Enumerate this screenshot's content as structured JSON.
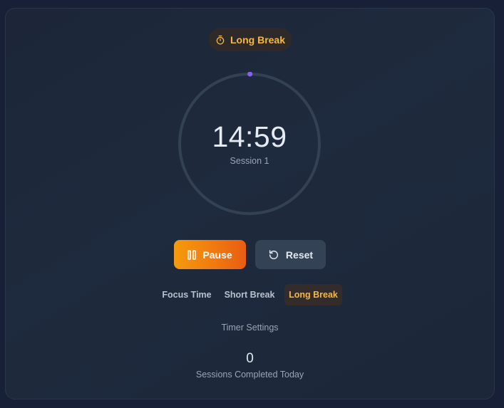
{
  "timer": {
    "mode_badge": "Long Break",
    "time": "14:59",
    "session": "Session 1",
    "progress": 0.001
  },
  "controls": {
    "pause_label": "Pause",
    "reset_label": "Reset"
  },
  "modes": [
    {
      "label": "Focus Time",
      "active": false
    },
    {
      "label": "Short Break",
      "active": false
    },
    {
      "label": "Long Break",
      "active": true
    }
  ],
  "settings_label": "Timer Settings",
  "stats": {
    "sessions_completed": "0",
    "sessions_label": "Sessions Completed Today"
  },
  "icons": {
    "badge": "stopwatch-icon",
    "pause": "pause-icon",
    "reset": "reset-icon"
  },
  "colors": {
    "accent": "#f5b942",
    "progress_dot": "#8b5cf6",
    "pause_gradient_start": "#f59b0c",
    "pause_gradient_end": "#e85d12"
  }
}
